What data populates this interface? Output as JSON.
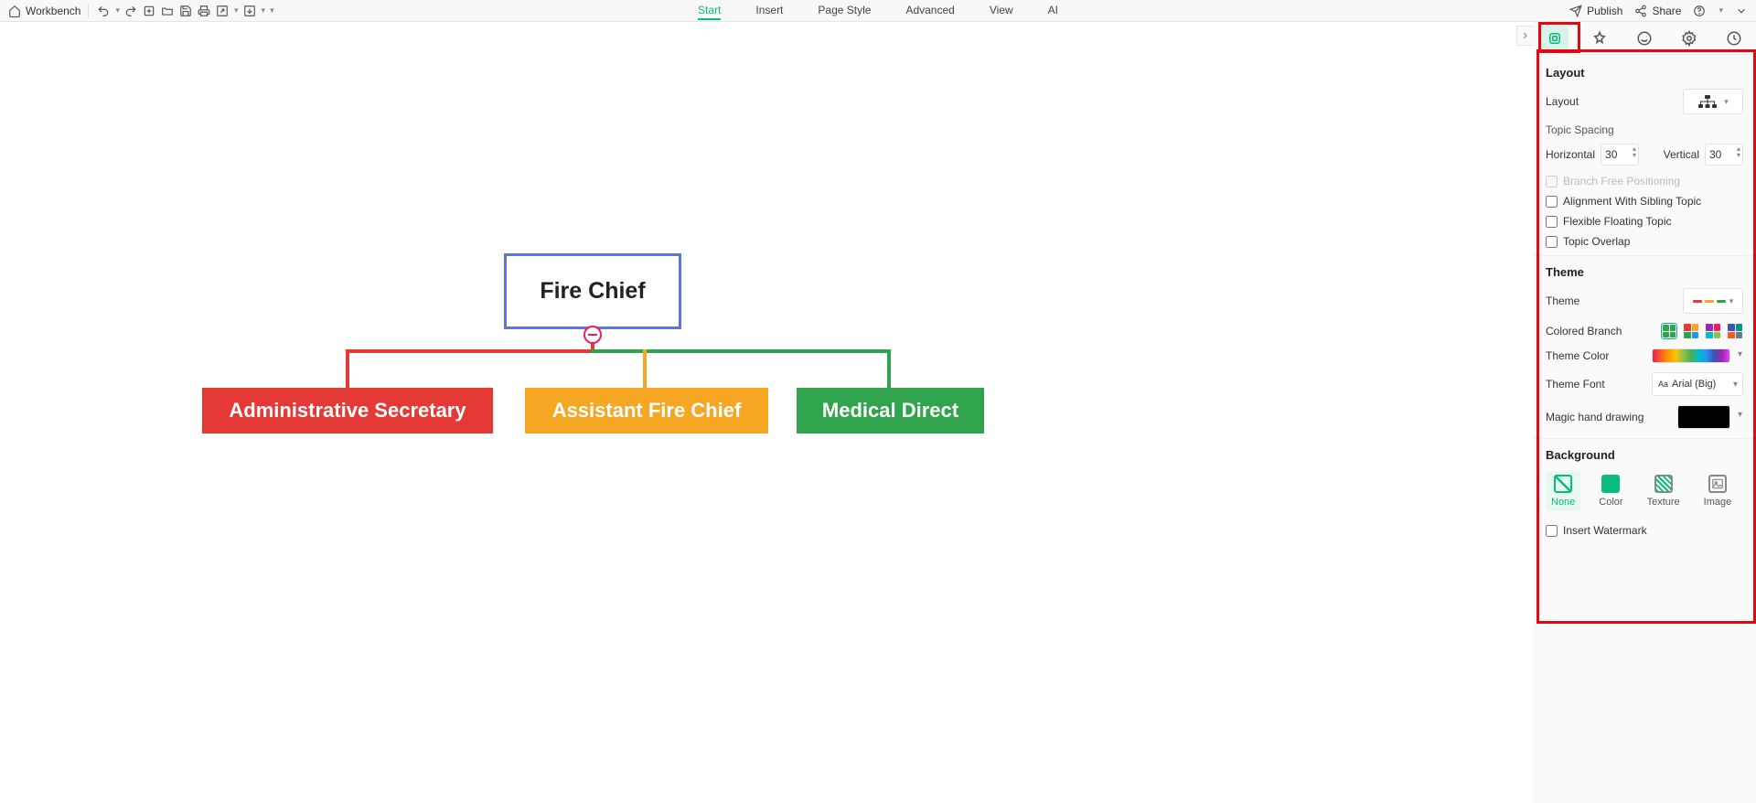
{
  "toolbar": {
    "workbench": "Workbench",
    "publish": "Publish",
    "share": "Share"
  },
  "menu": {
    "start": "Start",
    "insert": "Insert",
    "pageStyle": "Page Style",
    "advanced": "Advanced",
    "view": "View",
    "ai": "AI"
  },
  "mindmap": {
    "root": "Fire Chief",
    "children": [
      {
        "label": "Administrative Secretary",
        "color": "#e53935"
      },
      {
        "label": "Assistant Fire Chief",
        "color": "#f5a623"
      },
      {
        "label": "Medical Direct",
        "color": "#30a44c"
      }
    ]
  },
  "panel": {
    "layout": {
      "title": "Layout",
      "layoutLabel": "Layout",
      "topicSpacing": "Topic Spacing",
      "horizontal": "Horizontal",
      "horizontalValue": "30",
      "vertical": "Vertical",
      "verticalValue": "30",
      "branchFree": "Branch Free Positioning",
      "alignSibling": "Alignment With Sibling Topic",
      "flexFloat": "Flexible Floating Topic",
      "topicOverlap": "Topic Overlap"
    },
    "theme": {
      "title": "Theme",
      "themeLabel": "Theme",
      "coloredBranch": "Colored Branch",
      "themeColor": "Theme Color",
      "themeFont": "Theme Font",
      "themeFontValue": "Arial (Big)",
      "magicHand": "Magic hand drawing"
    },
    "background": {
      "title": "Background",
      "none": "None",
      "color": "Color",
      "texture": "Texture",
      "image": "Image",
      "watermark": "Insert Watermark"
    }
  },
  "chart_data": {
    "type": "tree",
    "root": "Fire Chief",
    "children": [
      {
        "name": "Administrative Secretary",
        "color": "#e53935"
      },
      {
        "name": "Assistant Fire Chief",
        "color": "#f5a623"
      },
      {
        "name": "Medical Direct",
        "color": "#30a44c"
      }
    ]
  }
}
